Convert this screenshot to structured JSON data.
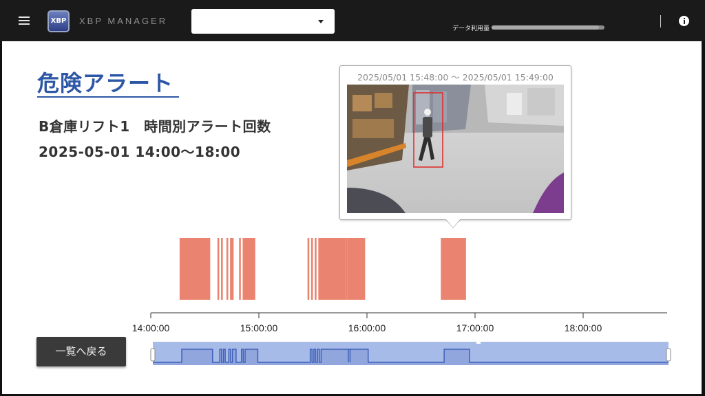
{
  "header": {
    "logo_text": "XBP",
    "app_name": "XBP MANAGER",
    "selector": {
      "value": ""
    },
    "usage": {
      "label": "データ利用量",
      "fraction": 0.95
    }
  },
  "page": {
    "title": "危険アラート",
    "subtitle": "B倉庫リフト1　時間別アラート回数",
    "date_range": "2025-05-01 14:00～18:00"
  },
  "popup": {
    "time_range": "2025/05/01 15:48:00 〜 2025/05/01 15:49:00"
  },
  "chart_data": {
    "type": "bar",
    "x_unit": "time",
    "xlim": [
      "14:00:00",
      "18:45:00"
    ],
    "ticks": [
      "14:00:00",
      "15:00:00",
      "16:00:00",
      "17:00:00",
      "18:00:00"
    ],
    "bar_color": "#ea8470",
    "events": [
      [
        "14:16:00",
        "14:33:00"
      ],
      [
        "14:37:00",
        "14:38:00"
      ],
      [
        "14:39:00",
        "14:40:00"
      ],
      [
        "14:42:00",
        "14:43:00"
      ],
      [
        "14:44:00",
        "14:46:00"
      ],
      [
        "14:49:00",
        "14:50:00"
      ],
      [
        "14:51:00",
        "14:58:00"
      ],
      [
        "15:27:00",
        "15:28:00"
      ],
      [
        "15:29:00",
        "15:30:00"
      ],
      [
        "15:31:00",
        "15:32:00"
      ],
      [
        "15:33:00",
        "15:48:00"
      ],
      [
        "15:48:00",
        "15:49:00"
      ],
      [
        "15:49:00",
        "15:59:00"
      ],
      [
        "16:41:00",
        "16:55:00"
      ]
    ],
    "overview": {
      "fill": "#a7bbe8",
      "line": "#4060b8",
      "range": [
        "14:00:00",
        "18:45:00"
      ]
    }
  },
  "back_button": {
    "label": "一覧へ戻る"
  }
}
